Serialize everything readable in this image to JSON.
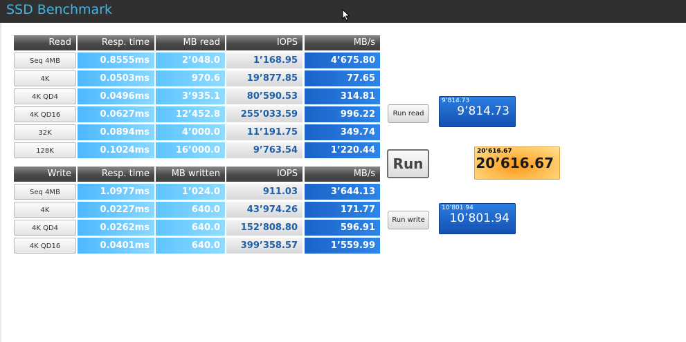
{
  "app": {
    "title": "SSD Benchmark"
  },
  "read": {
    "headers": [
      "Read",
      "Resp. time",
      "MB read",
      "IOPS",
      "MB/s"
    ],
    "rows": [
      {
        "label": "Seq 4MB",
        "resp": "0.8555ms",
        "mb": "2’048.0",
        "iops": "1’168.95",
        "mbs": "4’675.80"
      },
      {
        "label": "4K",
        "resp": "0.0503ms",
        "mb": "970.6",
        "iops": "19’877.85",
        "mbs": "77.65"
      },
      {
        "label": "4K QD4",
        "resp": "0.0496ms",
        "mb": "3’935.1",
        "iops": "80’590.53",
        "mbs": "314.81"
      },
      {
        "label": "4K QD16",
        "resp": "0.0627ms",
        "mb": "12’452.8",
        "iops": "255’033.59",
        "mbs": "996.22"
      },
      {
        "label": "32K",
        "resp": "0.0894ms",
        "mb": "4’000.0",
        "iops": "11’191.75",
        "mbs": "349.74"
      },
      {
        "label": "128K",
        "resp": "0.1024ms",
        "mb": "16’000.0",
        "iops": "9’763.54",
        "mbs": "1’220.44"
      }
    ]
  },
  "write": {
    "headers": [
      "Write",
      "Resp. time",
      "MB written",
      "IOPS",
      "MB/s"
    ],
    "rows": [
      {
        "label": "Seq 4MB",
        "resp": "1.0977ms",
        "mb": "1’024.0",
        "iops": "911.03",
        "mbs": "3’644.13"
      },
      {
        "label": "4K",
        "resp": "0.0227ms",
        "mb": "640.0",
        "iops": "43’974.26",
        "mbs": "171.77"
      },
      {
        "label": "4K QD4",
        "resp": "0.0262ms",
        "mb": "640.0",
        "iops": "152’808.80",
        "mbs": "596.91"
      },
      {
        "label": "4K QD16",
        "resp": "0.0401ms",
        "mb": "640.0",
        "iops": "399’358.57",
        "mbs": "1’559.99"
      }
    ]
  },
  "controls": {
    "run_read": "Run read",
    "run": "Run",
    "run_write": "Run write"
  },
  "scores": {
    "read": {
      "small": "9’814.73",
      "big": "9’814.73"
    },
    "total": {
      "small": "20’616.67",
      "big": "20’616.67"
    },
    "write": {
      "small": "10’801.94",
      "big": "10’801.94"
    }
  },
  "colors": {
    "title": "#41b6e6",
    "titlebar": "#303030",
    "mbs_blue": "#1a63c8",
    "resp_blue": "#4db8ff",
    "iops_text": "#1c5ea8",
    "total_orange": "#ff9a1a"
  },
  "icons": {
    "cursor": "mouse-pointer-icon"
  }
}
